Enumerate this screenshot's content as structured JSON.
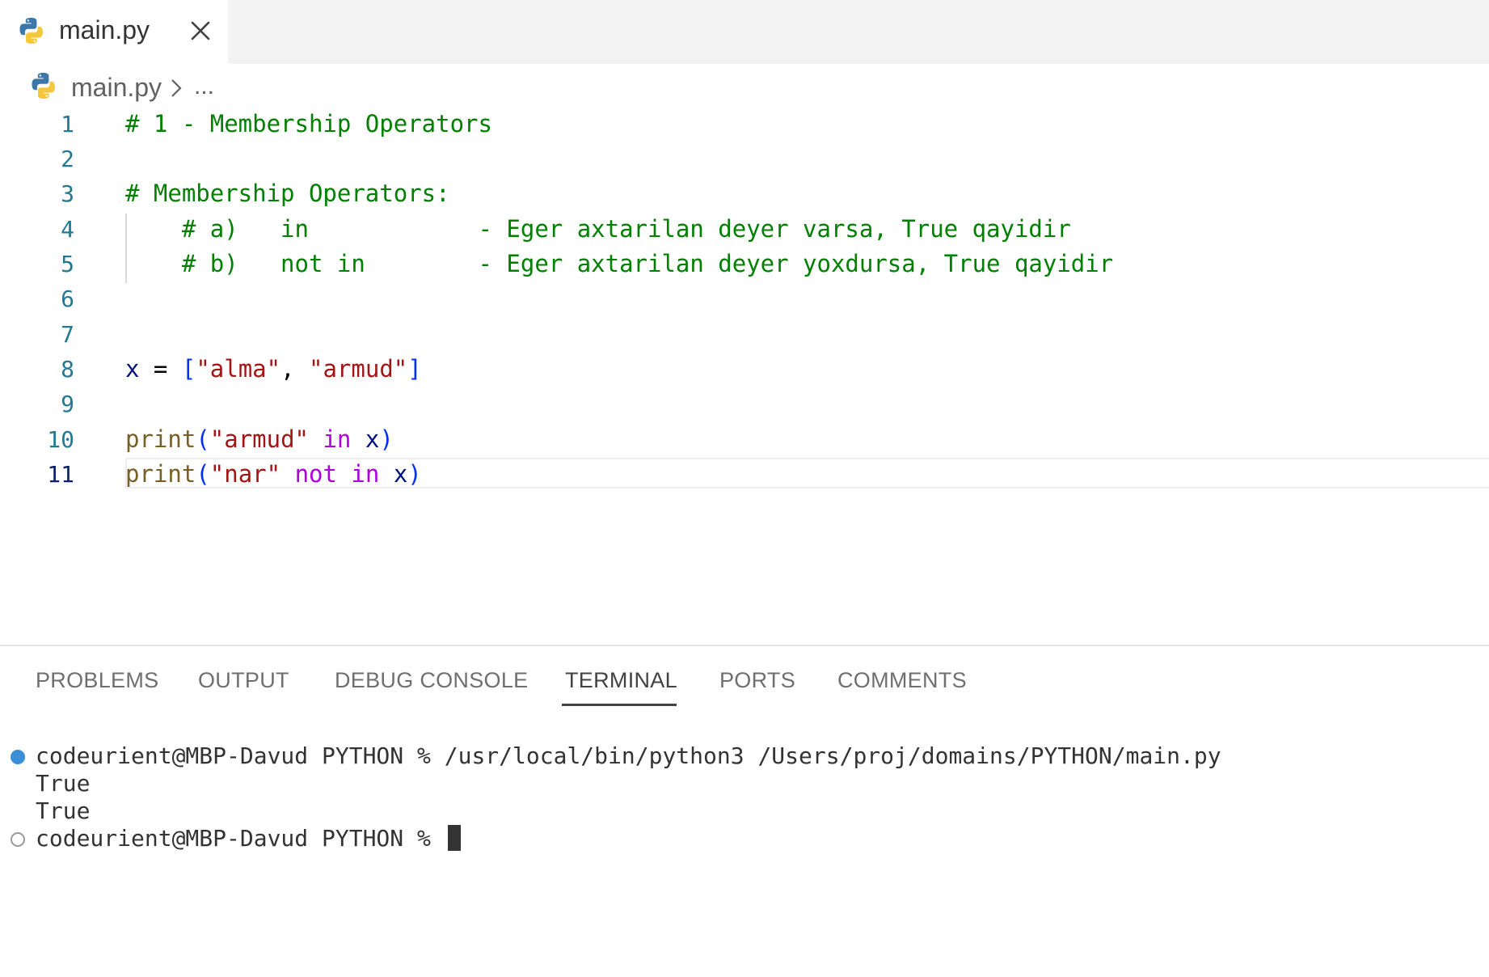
{
  "tab": {
    "label": "main.py"
  },
  "breadcrumb": {
    "file": "main.py",
    "more": "..."
  },
  "editor": {
    "line_numbers": [
      "1",
      "2",
      "3",
      "4",
      "5",
      "6",
      "7",
      "8",
      "9",
      "10",
      "11"
    ],
    "active_line": "11",
    "lines": {
      "l1": "# 1 - Membership Operators",
      "l3": "# Membership Operators:",
      "l4": "    # a)   in            - Eger axtarilan deyer varsa, True qayidir",
      "l5": "    # b)   not in        - Eger axtarilan deyer yoxdursa, True qayidir",
      "l8": {
        "var": "x",
        "eq": " = ",
        "open": "[",
        "s1": "\"alma\"",
        "comma": ", ",
        "s2": "\"armud\"",
        "close": "]"
      },
      "l10": {
        "func": "print",
        "open": "(",
        "str": "\"armud\"",
        "sp": " ",
        "kw": "in",
        "sp2": " ",
        "var": "x",
        "close": ")"
      },
      "l11": {
        "func": "print",
        "open": "(",
        "str": "\"nar\"",
        "sp": " ",
        "kw1": "not",
        "sp2": " ",
        "kw2": "in",
        "sp3": " ",
        "var": "x",
        "close": ")"
      }
    }
  },
  "panel": {
    "tabs": [
      "PROBLEMS",
      "OUTPUT",
      "DEBUG CONSOLE",
      "TERMINAL",
      "PORTS",
      "COMMENTS"
    ],
    "active_tab": "TERMINAL"
  },
  "terminal": {
    "lines": [
      "codeurient@MBP-Davud PYTHON % /usr/local/bin/python3 /Users/proj/domains/PYTHON/main.py",
      "True",
      "True",
      "codeurient@MBP-Davud PYTHON % "
    ]
  },
  "colors": {
    "comment": "#008000",
    "function": "#795e26",
    "string": "#a31515",
    "keyword": "#af00db",
    "variable": "#001080",
    "line_number": "#237893",
    "terminal_dot": "#3c8fd6"
  }
}
